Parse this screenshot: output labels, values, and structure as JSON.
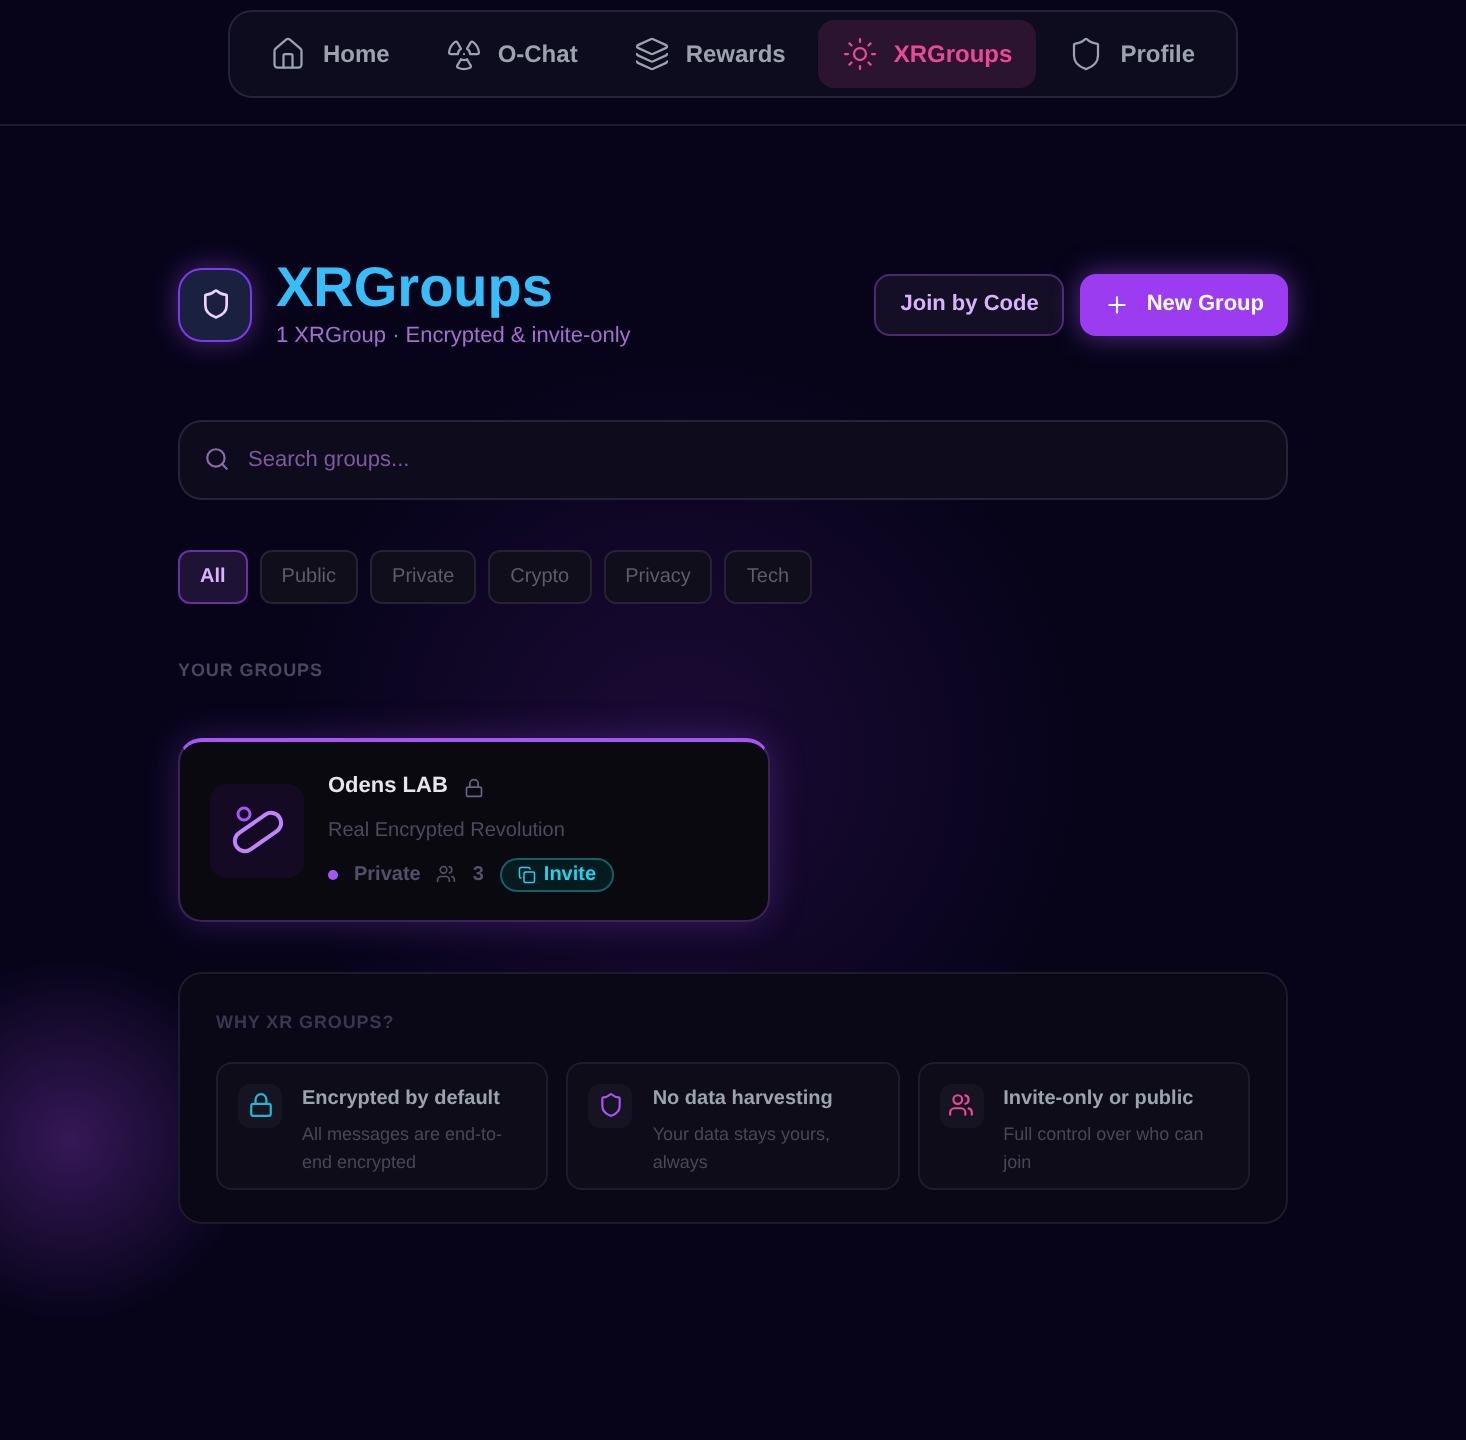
{
  "nav": [
    {
      "label": "Home",
      "kind": "home",
      "selected": false
    },
    {
      "label": "O-Chat",
      "kind": "chat",
      "selected": false
    },
    {
      "label": "Rewards",
      "kind": "rewards",
      "selected": false
    },
    {
      "label": "XRGroups",
      "kind": "groups",
      "selected": true
    },
    {
      "label": "Profile",
      "kind": "profile",
      "selected": false
    }
  ],
  "header": {
    "title": "XRGroups",
    "subtitle": "1 XRGroup · Encrypted & invite-only",
    "join_button": "Join by Code",
    "new_button": "New Group"
  },
  "search": {
    "placeholder": "Search groups..."
  },
  "filters": [
    {
      "label": "All",
      "selected": true
    },
    {
      "label": "Public",
      "selected": false
    },
    {
      "label": "Private",
      "selected": false
    },
    {
      "label": "Crypto",
      "selected": false
    },
    {
      "label": "Privacy",
      "selected": false
    },
    {
      "label": "Tech",
      "selected": false
    }
  ],
  "section_title": "YOUR GROUPS",
  "groups": [
    {
      "name": "Odens LAB",
      "locked": true,
      "description": "Real Encrypted Revolution",
      "privacy": "Private",
      "members": "3",
      "invite": "Invite"
    }
  ],
  "why": {
    "title": "WHY XR GROUPS?",
    "features": [
      {
        "kind": "lock",
        "color": "#22b8cf",
        "title": "Encrypted by default",
        "text": "All messages are end-to-end encrypted"
      },
      {
        "kind": "shield",
        "color": "#a855f7",
        "title": "No data harvesting",
        "text": "Your data stays yours, always"
      },
      {
        "kind": "users",
        "color": "#ec4899",
        "title": "Invite-only or public",
        "text": "Full control over who can join"
      }
    ]
  }
}
